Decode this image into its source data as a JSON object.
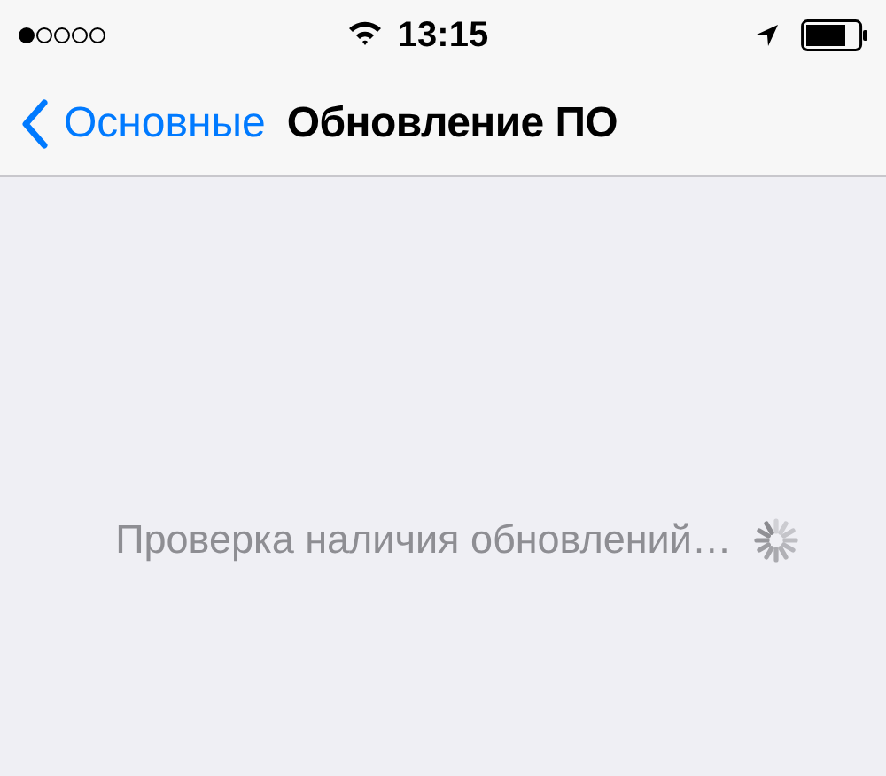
{
  "status_bar": {
    "time": "13:15"
  },
  "nav_bar": {
    "back": "Основные",
    "title": "Обновление ПО"
  },
  "content": {
    "message": "Проверка наличия обновлений…"
  }
}
